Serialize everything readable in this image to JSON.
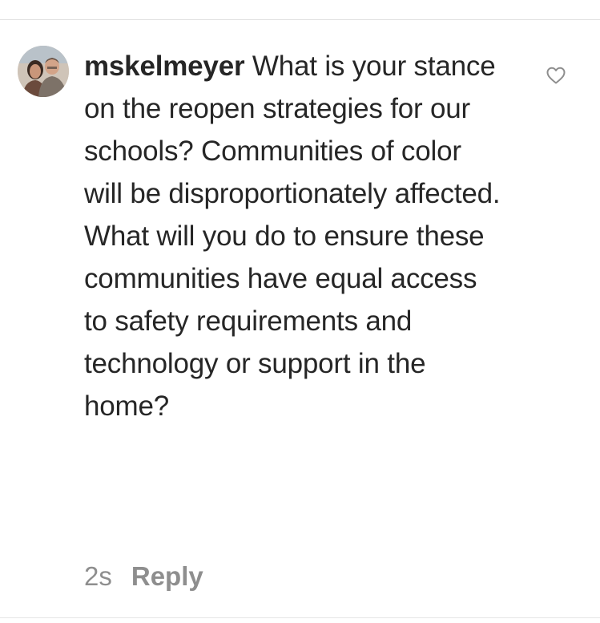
{
  "comment": {
    "username": "mskelmeyer",
    "text": "What is your stance on the reopen strategies for our schools? Communities of color will be disproportionately affected. What will you do to ensure these communities have equal access to safety requirements and technology or support in the home?",
    "timestamp": "2s",
    "reply_label": "Reply",
    "like_icon": "heart-outline-icon",
    "avatar_icon": "user-avatar"
  },
  "colors": {
    "text": "#262626",
    "secondary_text": "#8e8e8e",
    "divider": "#e2e2e2",
    "background": "#ffffff"
  }
}
